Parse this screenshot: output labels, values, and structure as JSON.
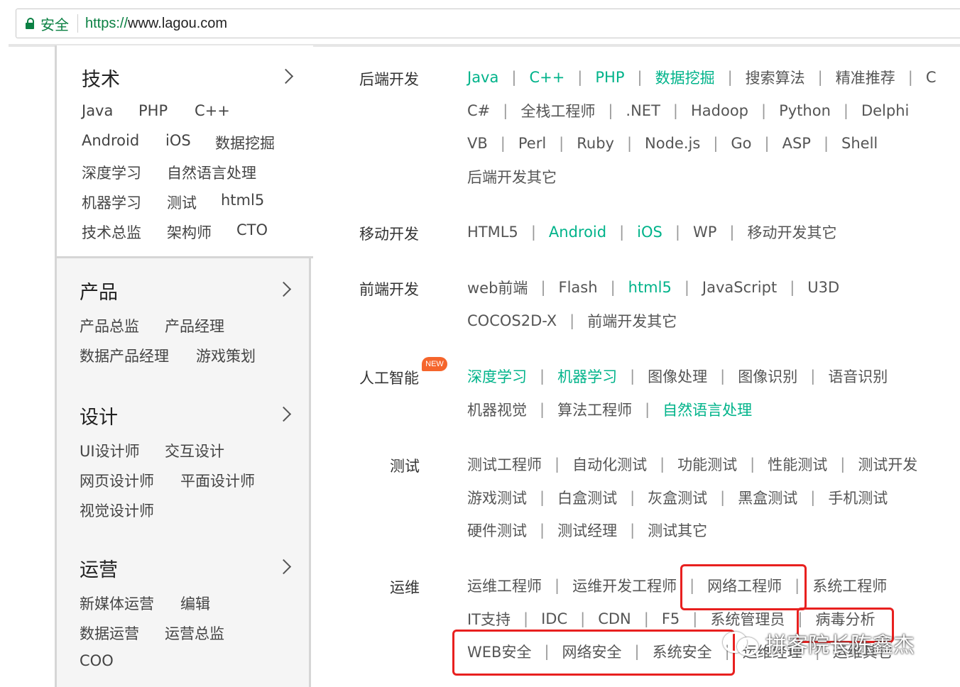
{
  "browser": {
    "secure_label": "安全",
    "url_scheme": "https://",
    "url_host": "www.lagou.com"
  },
  "left_menu": [
    {
      "title": "技术",
      "rows": [
        [
          "Java",
          "PHP",
          "C++"
        ],
        [
          "Android",
          "iOS",
          "数据挖掘"
        ],
        [
          "深度学习",
          "自然语言处理"
        ],
        [
          "机器学习",
          "测试",
          "html5"
        ],
        [
          "技术总监",
          "架构师",
          "CTO"
        ]
      ]
    },
    {
      "title": "产品",
      "rows": [
        [
          "产品总监",
          "产品经理"
        ],
        [
          "数据产品经理",
          "游戏策划"
        ]
      ]
    },
    {
      "title": "设计",
      "rows": [
        [
          "UI设计师",
          "交互设计"
        ],
        [
          "网页设计师",
          "平面设计师"
        ],
        [
          "视觉设计师"
        ]
      ]
    },
    {
      "title": "运营",
      "rows": [
        [
          "新媒体运营",
          "编辑"
        ],
        [
          "数据运营",
          "运营总监"
        ],
        [
          "COO"
        ]
      ]
    }
  ],
  "sections": [
    {
      "label": "后端开发",
      "rows": [
        [
          [
            "Java",
            1
          ],
          [
            "C++",
            1
          ],
          [
            "PHP",
            1
          ],
          [
            "数据挖掘",
            1
          ],
          [
            "搜索算法",
            0
          ],
          [
            "精准推荐",
            0
          ],
          [
            "C",
            0
          ]
        ],
        [
          [
            "C#",
            0
          ],
          [
            "全栈工程师",
            0
          ],
          [
            ".NET",
            0
          ],
          [
            "Hadoop",
            0
          ],
          [
            "Python",
            0
          ],
          [
            "Delphi",
            0
          ]
        ],
        [
          [
            "VB",
            0
          ],
          [
            "Perl",
            0
          ],
          [
            "Ruby",
            0
          ],
          [
            "Node.js",
            0
          ],
          [
            "Go",
            0
          ],
          [
            "ASP",
            0
          ],
          [
            "Shell",
            0
          ]
        ],
        [
          [
            "后端开发其它",
            0
          ]
        ]
      ]
    },
    {
      "label": "移动开发",
      "rows": [
        [
          [
            "HTML5",
            0
          ],
          [
            "Android",
            1
          ],
          [
            "iOS",
            1
          ],
          [
            "WP",
            0
          ],
          [
            "移动开发其它",
            0
          ]
        ]
      ]
    },
    {
      "label": "前端开发",
      "rows": [
        [
          [
            "web前端",
            0
          ],
          [
            "Flash",
            0
          ],
          [
            "html5",
            1
          ],
          [
            "JavaScript",
            0
          ],
          [
            "U3D",
            0
          ]
        ],
        [
          [
            "COCOS2D-X",
            0
          ],
          [
            "前端开发其它",
            0
          ]
        ]
      ]
    },
    {
      "label": "人工智能",
      "badge": "NEW",
      "rows": [
        [
          [
            "深度学习",
            1
          ],
          [
            "机器学习",
            1
          ],
          [
            "图像处理",
            0
          ],
          [
            "图像识别",
            0
          ],
          [
            "语音识别",
            0
          ]
        ],
        [
          [
            "机器视觉",
            0
          ],
          [
            "算法工程师",
            0
          ],
          [
            "自然语言处理",
            1
          ]
        ]
      ]
    },
    {
      "label": "测试",
      "rows": [
        [
          [
            "测试工程师",
            0
          ],
          [
            "自动化测试",
            0
          ],
          [
            "功能测试",
            0
          ],
          [
            "性能测试",
            0
          ],
          [
            "测试开发",
            0
          ]
        ],
        [
          [
            "游戏测试",
            0
          ],
          [
            "白盒测试",
            0
          ],
          [
            "灰盒测试",
            0
          ],
          [
            "黑盒测试",
            0
          ],
          [
            "手机测试",
            0
          ]
        ],
        [
          [
            "硬件测试",
            0
          ],
          [
            "测试经理",
            0
          ],
          [
            "测试其它",
            0
          ]
        ]
      ]
    },
    {
      "label": "运维",
      "rows": [
        [
          [
            "运维工程师",
            0
          ],
          [
            "运维开发工程师",
            0
          ],
          [
            "网络工程师",
            0
          ],
          [
            "系统工程师",
            0
          ]
        ],
        [
          [
            "IT支持",
            0
          ],
          [
            "IDC",
            0
          ],
          [
            "CDN",
            0
          ],
          [
            "F5",
            0
          ],
          [
            "系统管理员",
            0
          ],
          [
            "病毒分析",
            0
          ]
        ],
        [
          [
            "WEB安全",
            0
          ],
          [
            "网络安全",
            0
          ],
          [
            "系统安全",
            0
          ],
          [
            "运维经理",
            0
          ],
          [
            "运维其它",
            0
          ]
        ]
      ]
    }
  ],
  "watermark": "拼客院长陈鑫杰",
  "colors": {
    "highlight": "#00b38a",
    "annotation_red": "#e8201f",
    "secure_green": "#0b8043"
  }
}
